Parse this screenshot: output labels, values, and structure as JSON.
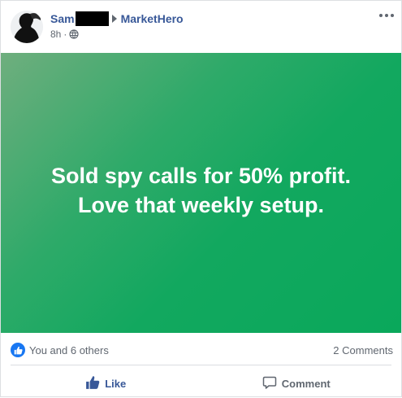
{
  "post": {
    "author": "Sam",
    "group": "MarketHero",
    "time": "8h",
    "separator": "·",
    "text_line1": "Sold spy calls for 50% profit.",
    "text_line2": "Love that weekly setup."
  },
  "reactions": {
    "likes_text": "You and 6 others",
    "comments_text": "2 Comments"
  },
  "actions": {
    "like_label": "Like",
    "comment_label": "Comment"
  },
  "colors": {
    "link": "#385898",
    "accent": "#1877f2",
    "gradient_start": "#6fae7e",
    "gradient_end": "#0aa85b"
  },
  "icons": {
    "more": "more-options-icon",
    "privacy": "globe-icon",
    "reaction": "like-reaction-icon",
    "like_action": "thumbs-up-icon",
    "comment_action": "comment-icon",
    "group_arrow": "right-arrow-icon"
  }
}
